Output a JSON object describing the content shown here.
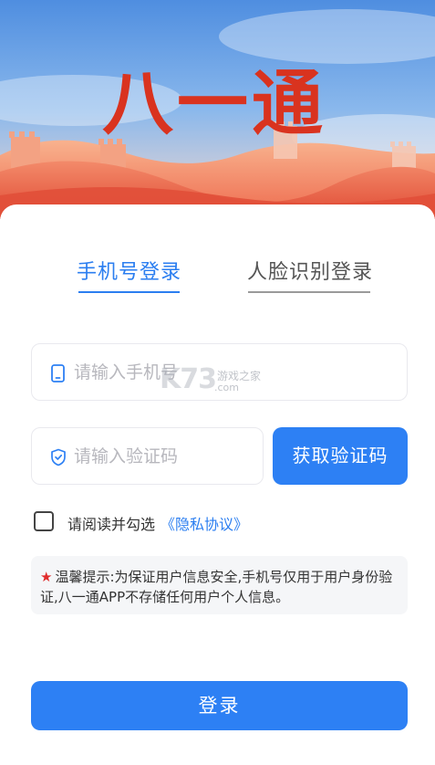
{
  "banner": {
    "logo_text": "八一通"
  },
  "tabs": {
    "phone_login": "手机号登录",
    "face_login": "人脸识别登录"
  },
  "form": {
    "phone_placeholder": "请输入手机号",
    "code_placeholder": "请输入验证码",
    "get_code_label": "获取验证码"
  },
  "watermark": {
    "brand": "K73",
    "cn": "游戏之家",
    "domain": ".com"
  },
  "agreement": {
    "text": "请阅读并勾选",
    "link": "《隐私协议》",
    "checked": false
  },
  "notice": {
    "star": "★",
    "text": "温馨提示:为保证用户信息安全,手机号仅用于用户身份验证,八一通APP不存储任何用户个人信息。"
  },
  "login_button": {
    "label": "登录"
  },
  "colors": {
    "primary": "#2d80f4",
    "star": "#e02c2c",
    "banner_red": "#e8593f"
  }
}
